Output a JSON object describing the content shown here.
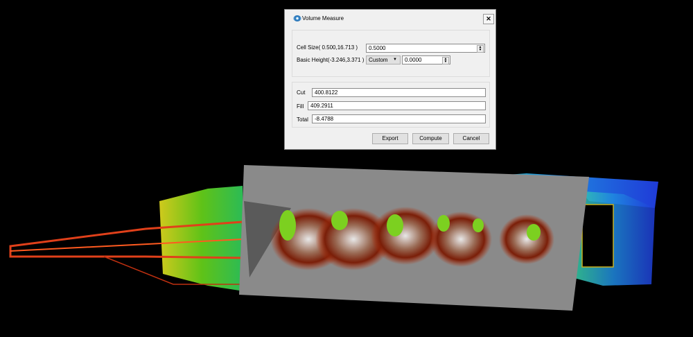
{
  "dialog": {
    "title": "Volume Measure",
    "close_icon": "close-icon",
    "cell_size_label": "Cell Size( 0.500,16.713 )",
    "cell_size_value": "0.5000",
    "basic_height_label": "Basic Height(-3.246,3.371 )",
    "basic_height_mode": "Custom",
    "basic_height_value": "0.0000",
    "cut_label": "Cut",
    "cut_value": "400.8122",
    "fill_label": "Fill",
    "fill_value": "409.2911",
    "total_label": "Total",
    "total_value": "-8.4788",
    "export_label": "Export",
    "compute_label": "Compute",
    "cancel_label": "Cancel"
  },
  "colors": {
    "background": "#000000",
    "surface": "#8a8a8a",
    "cut": "#c0300a",
    "high": "#1f3bd8",
    "mid": "#6ad81a"
  }
}
